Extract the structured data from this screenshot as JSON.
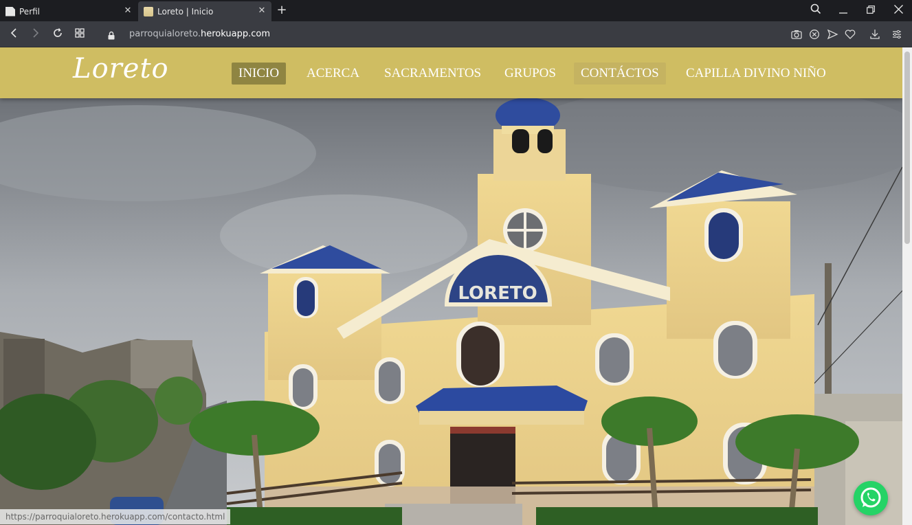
{
  "browser": {
    "tabs": [
      {
        "title": "Perfil",
        "active": false
      },
      {
        "title": "Loreto | Inicio",
        "active": true
      }
    ],
    "url_prefix": "parroquialoreto.",
    "url_host": "herokuapp.com",
    "status_link": "https://parroquialoreto.herokuapp.com/contacto.html",
    "icons": [
      "back-icon",
      "forward-icon",
      "reload-icon",
      "speed-dial-icon",
      "lock-icon",
      "snapshot-icon",
      "ad-block-icon",
      "send-icon",
      "heart-icon",
      "download-icon",
      "settings-icon",
      "search-icon"
    ]
  },
  "site": {
    "logo": "Loreto",
    "nav": [
      {
        "label": "INICIO",
        "state": "active"
      },
      {
        "label": "ACERCA",
        "state": "normal"
      },
      {
        "label": "SACRAMENTOS",
        "state": "normal"
      },
      {
        "label": "GRUPOS",
        "state": "normal"
      },
      {
        "label": "CONTÁCTOS",
        "state": "hover"
      },
      {
        "label": "CAPILLA DIVINO NIÑO",
        "state": "normal"
      }
    ],
    "church_sign": "LORETO",
    "colors": {
      "navbar": "#cfbd62",
      "nav_active": "#8f8542",
      "whatsapp": "#25d366"
    }
  }
}
